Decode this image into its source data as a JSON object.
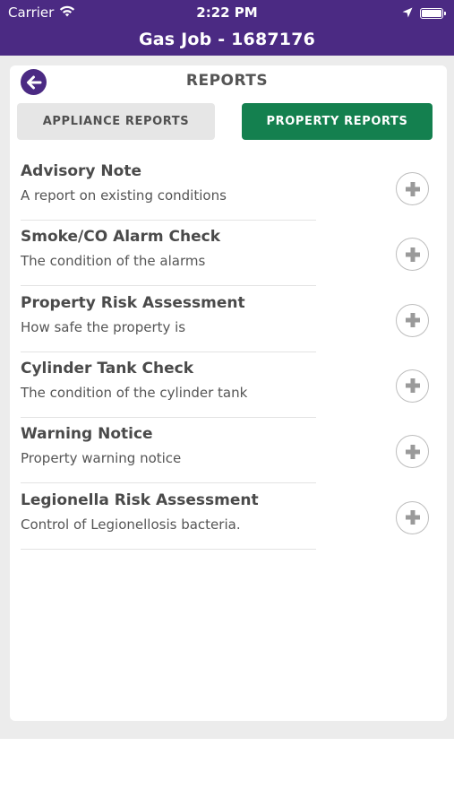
{
  "status_bar": {
    "carrier": "Carrier",
    "time": "2:22 PM",
    "icons": [
      "wifi-icon",
      "location-arrow-icon",
      "battery-icon"
    ]
  },
  "header": {
    "title": "Gas Job - 1687176",
    "background_color": "#4b2a83"
  },
  "page": {
    "title": "REPORTS",
    "back_icon": "arrow-left-icon"
  },
  "tabs": [
    {
      "label": "APPLIANCE REPORTS",
      "active": false
    },
    {
      "label": "PROPERTY REPORTS",
      "active": true,
      "color": "#14804f"
    }
  ],
  "reports": [
    {
      "title": "Advisory Note",
      "description": "A report on existing conditions"
    },
    {
      "title": "Smoke/CO Alarm Check",
      "description": "The condition of the alarms"
    },
    {
      "title": "Property Risk Assessment",
      "description": "How safe the property is"
    },
    {
      "title": "Cylinder Tank Check",
      "description": "The condition of the cylinder tank"
    },
    {
      "title": "Warning Notice",
      "description": "Property warning notice"
    },
    {
      "title": "Legionella Risk Assessment",
      "description": "Control of Legionellosis bacteria."
    }
  ]
}
